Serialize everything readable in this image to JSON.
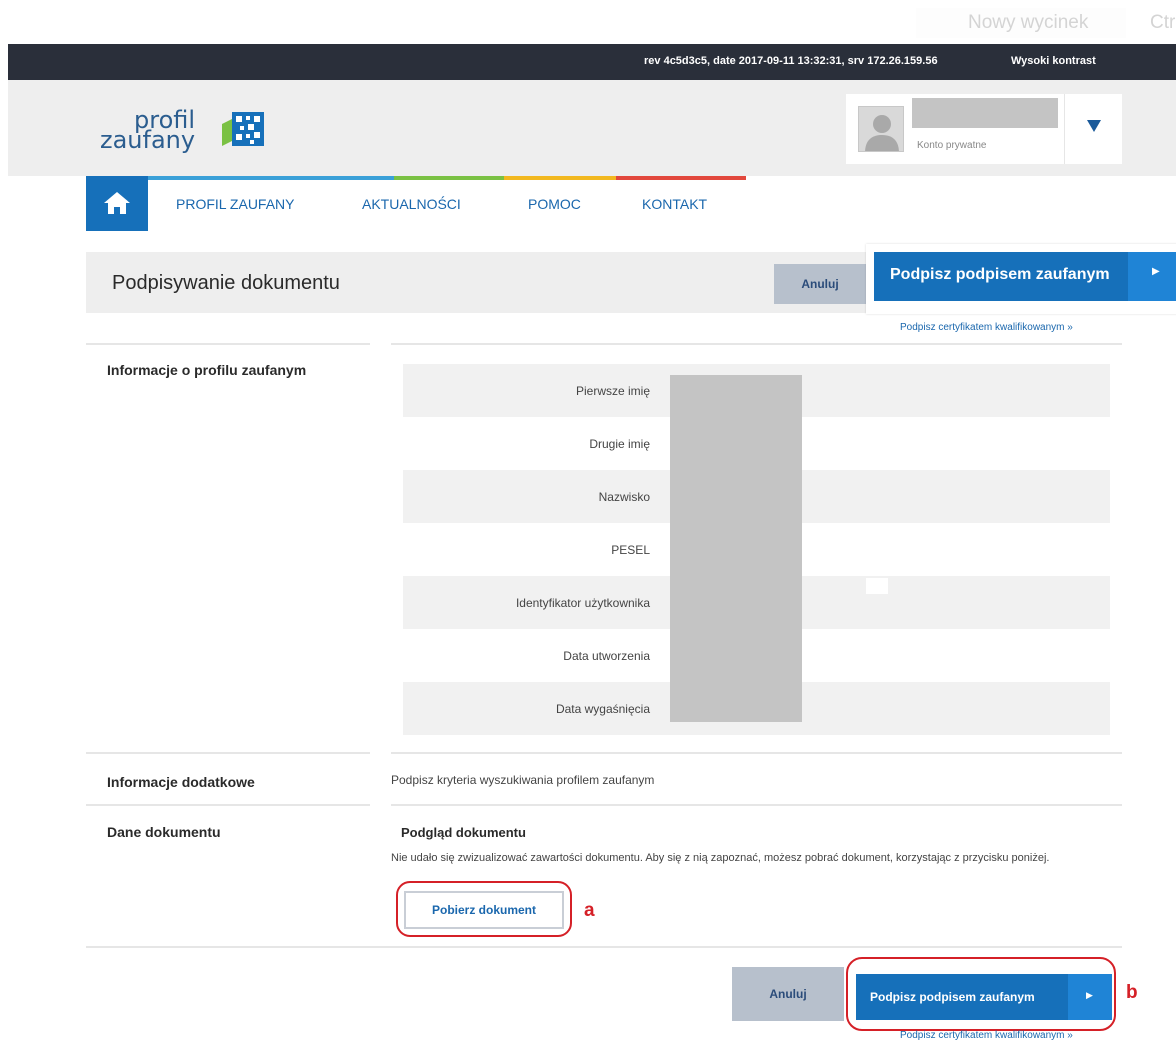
{
  "snip_toolbar": {
    "new_snip": "Nowy wycinek",
    "ctrl": "Ctr"
  },
  "topbar": {
    "revision": "rev 4c5d3c5, date 2017-09-11 13:32:31, srv 172.26.159.56",
    "high_contrast": "Wysoki kontrast"
  },
  "logo": {
    "line1": "profil",
    "line2": "zaufany"
  },
  "account": {
    "type": "Konto prywatne",
    "toggle_icon": "triangle-down-icon"
  },
  "nav": {
    "home_icon": "home-icon",
    "items": [
      "PROFIL ZAUFANY",
      "AKTUALNOŚCI",
      "POMOC",
      "KONTAKT"
    ]
  },
  "title_bar": {
    "title": "Podpisywanie dokumentu",
    "cancel": "Anuluj",
    "sign": "Podpisz podpisem zaufanym"
  },
  "cert_link": "Podpisz certyfikatem kwalifikowanym »",
  "profile_info": {
    "label": "Informacje o profilu zaufanym",
    "fields": [
      "Pierwsze imię",
      "Drugie imię",
      "Nazwisko",
      "PESEL",
      "Identyfikator użytkownika",
      "Data utworzenia",
      "Data wygaśnięcia"
    ]
  },
  "additional": {
    "label": "Informacje dodatkowe",
    "value": "Podpisz kryteria wyszukiwania profilem zaufanym"
  },
  "document": {
    "label": "Dane dokumentu",
    "preview_title": "Podgląd dokumentu",
    "preview_text": "Nie udało się zwizualizować zawartości dokumentu. Aby się z nią zapoznać, możesz pobrać dokument, korzystając z przycisku poniżej.",
    "download": "Pobierz dokument"
  },
  "annotations": {
    "a": "a",
    "b": "b"
  },
  "bottom": {
    "cancel": "Anuluj",
    "sign": "Podpisz podpisem zaufanym",
    "cert_link": "Podpisz certyfikatem kwalifikowanym »"
  },
  "colors": {
    "primary": "#1670ba",
    "topbar": "#2a2f3a",
    "annotation": "#d52027"
  }
}
